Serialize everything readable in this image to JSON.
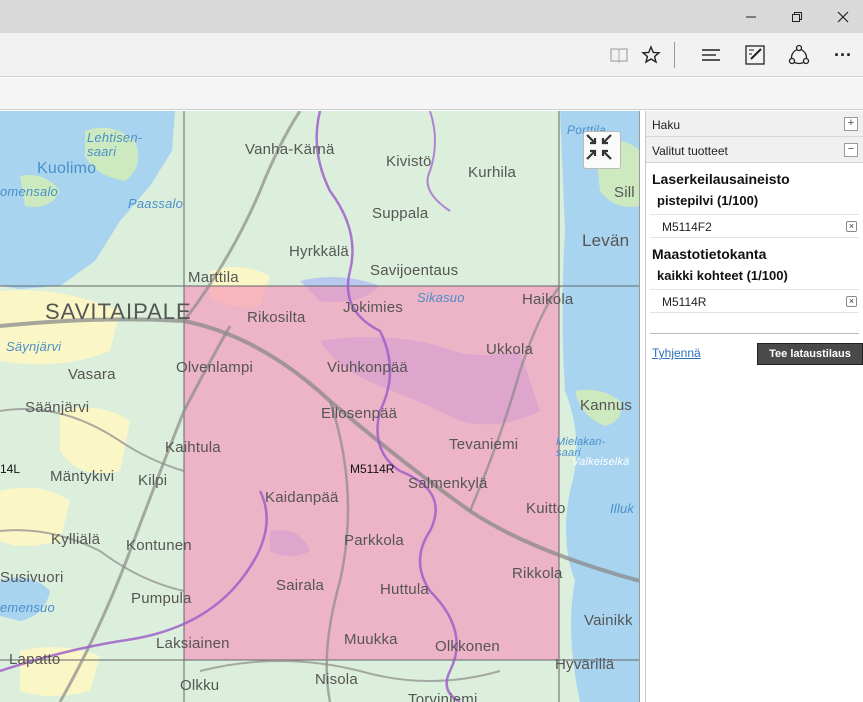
{
  "window": {
    "controls": {
      "minimize_icon": "minimize-icon",
      "restore_icon": "restore-icon",
      "close_icon": "close-icon"
    }
  },
  "toolbar": {
    "icons": [
      "reading-view-icon",
      "favorite-star-icon",
      "hub-icon",
      "web-note-icon",
      "share-icon",
      "more-icon"
    ],
    "more_label": "···"
  },
  "map": {
    "sheet_label": "M5114R",
    "edge_label": "14L",
    "places": {
      "vanha_karna": "Vanha-Kärnä",
      "kivisto": "Kivistö",
      "kurhila": "Kurhila",
      "kuolimo": "Kuolimo",
      "lehtisensaari": "Lehtisen-\nsaari",
      "omensalo": "omensalo",
      "paassalo": "Paassalo",
      "suppala": "Suppala",
      "sill": "Sill",
      "leva": "Levän",
      "hyrkkala": "Hyrkkälä",
      "marttila": "Marttila",
      "savijoentaus": "Savijoentaus",
      "savitaipale": "SAVITAIPALE",
      "sikasuo": "Sikasuo",
      "haikola": "Haikola",
      "jokimies": "Jokimies",
      "rikosilta": "Rikosilta",
      "saynjarvi": "Säynjärvi",
      "ukkola": "Ukkola",
      "vasara": "Vasara",
      "olvenlampi": "Olvenlampi",
      "viuhkonpaa": "Viuhkonpää",
      "saanjarvi": "Säänjärvi",
      "kannus": "Kannus",
      "ellosenpaa": "Ellosenpää",
      "kaihtula": "Kaihtula",
      "tevaniemi": "Tevaniemi",
      "mielakansaari": "Mielakan-\nsaari",
      "valkeiselka": "Valkeiselkä",
      "mantykivi": "Mäntykivi",
      "kilpi": "Kilpi",
      "salmenkyla": "Salmenkylä",
      "kaidanpaa": "Kaidanpää",
      "kuitto": "Kuitto",
      "illuk": "Illuk",
      "kyllala": "Kylliälä",
      "kontunen": "Kontunen",
      "parkkola": "Parkkola",
      "susivuori": "Susivuori",
      "rikkola": "Rikkola",
      "sairala": "Sairala",
      "huttula": "Huttula",
      "pumpula": "Pumpula",
      "emensuo": "emensuo",
      "vainikk": "Vainikk",
      "laksiainen": "Laksiainen",
      "muukka": "Muukka",
      "olkkonen": "Olkkonen",
      "lapatto": "Lapatto",
      "hyvarilla": "Hyvärillä",
      "olkku": "Olkku",
      "nisola": "Nisola",
      "torviniemi": "Torviniemi",
      "porttila": "Porttila"
    },
    "collapse_icon": "collapse-arrows-icon"
  },
  "panel": {
    "haku": {
      "label": "Haku",
      "toggle": "+"
    },
    "valitut": {
      "label": "Valitut tuotteet",
      "toggle": "−"
    },
    "groups": [
      {
        "title": "Laserkeilausaineisto",
        "subtitle": "pistepilvi (1/100)",
        "item": "M5114F2"
      },
      {
        "title": "Maastotietokanta",
        "subtitle": "kaikki kohteet (1/100)",
        "item": "M5114R"
      }
    ],
    "delete_glyph": "×",
    "clear_label": "Tyhjennä",
    "order_label": "Tee lataustilaus"
  }
}
